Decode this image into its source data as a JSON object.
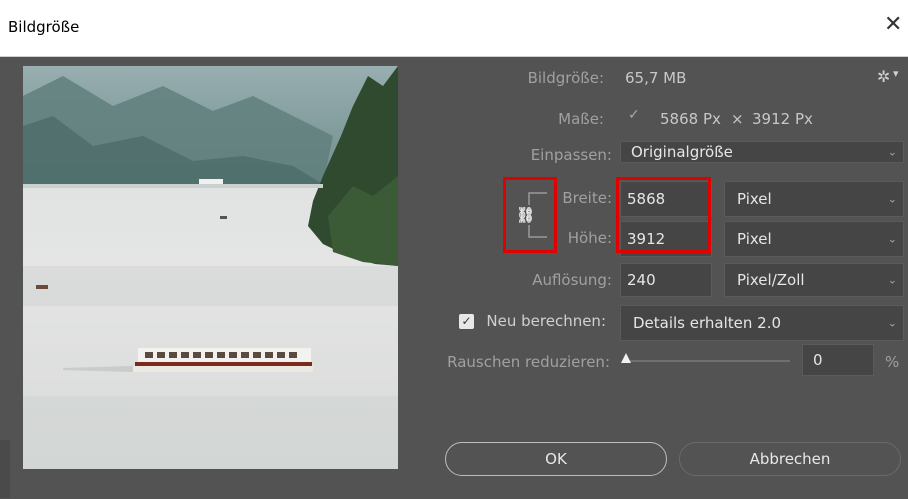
{
  "window": {
    "title": "Bildgröße"
  },
  "info": {
    "size_label": "Bildgröße:",
    "size_value": "65,7 MB",
    "dims_label": "Maße:",
    "width_px": "5868 Px",
    "times": "×",
    "height_px": "3912 Px"
  },
  "fit": {
    "label": "Einpassen:",
    "value": "Originalgröße"
  },
  "width": {
    "label": "Breite:",
    "value": "5868",
    "unit": "Pixel"
  },
  "height": {
    "label": "Höhe:",
    "value": "3912",
    "unit": "Pixel"
  },
  "resolution": {
    "label": "Auflösung:",
    "value": "240",
    "unit": "Pixel/Zoll"
  },
  "resample": {
    "label": "Neu berechnen:",
    "checked": true,
    "value": "Details erhalten 2.0"
  },
  "noise": {
    "label": "Rauschen reduzieren:",
    "value": "0",
    "unit": "%"
  },
  "buttons": {
    "ok": "OK",
    "cancel": "Abbrechen"
  },
  "colors": {
    "highlight": "#e00000",
    "panel": "#535353",
    "field": "#454545"
  }
}
